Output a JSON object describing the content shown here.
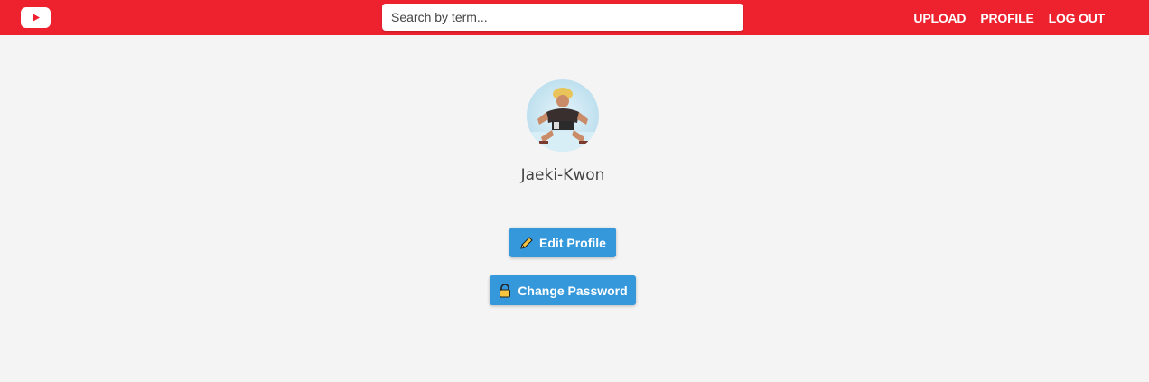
{
  "header": {
    "logo_icon": "play-logo-icon",
    "search_placeholder": "Search by term...",
    "nav": [
      "UPLOAD",
      "PROFILE",
      "LOG OUT"
    ],
    "bar_color": "#ee222f"
  },
  "profile": {
    "username": "Jaeki-Kwon",
    "avatar_icon": "profile-avatar-image"
  },
  "actions": {
    "edit_label": "Edit Profile",
    "edit_icon": "pencil-icon",
    "password_label": "Change Password",
    "password_icon": "lock-icon",
    "button_color": "#3498db"
  }
}
